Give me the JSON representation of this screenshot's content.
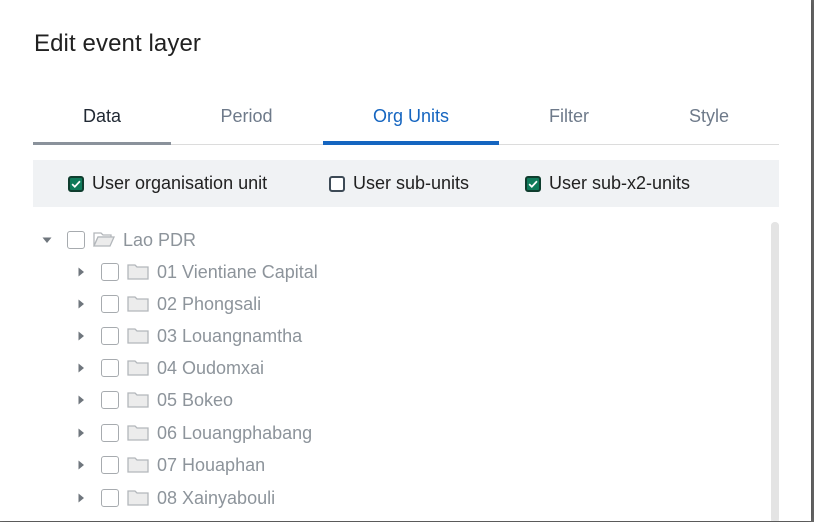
{
  "dialog": {
    "title": "Edit event layer"
  },
  "tabs": [
    {
      "label": "Data",
      "state": "visited"
    },
    {
      "label": "Period",
      "state": "inactive"
    },
    {
      "label": "Org Units",
      "state": "active"
    },
    {
      "label": "Filter",
      "state": "inactive"
    },
    {
      "label": "Style",
      "state": "inactive"
    }
  ],
  "user_levels": [
    {
      "label": "User organisation unit",
      "checked": true
    },
    {
      "label": "User sub-units",
      "checked": false
    },
    {
      "label": "User sub-x2-units",
      "checked": true
    }
  ],
  "tree": {
    "root": {
      "label": "Lao PDR",
      "expanded": true,
      "checked": false,
      "icon": "folder-open-icon"
    },
    "children": [
      {
        "label": "01 Vientiane Capital",
        "checked": false,
        "icon": "folder-icon"
      },
      {
        "label": "02 Phongsali",
        "checked": false,
        "icon": "folder-icon"
      },
      {
        "label": "03 Louangnamtha",
        "checked": false,
        "icon": "folder-icon"
      },
      {
        "label": "04 Oudomxai",
        "checked": false,
        "icon": "folder-icon"
      },
      {
        "label": "05 Bokeo",
        "checked": false,
        "icon": "folder-icon"
      },
      {
        "label": "06 Louangphabang",
        "checked": false,
        "icon": "folder-icon"
      },
      {
        "label": "07 Houaphan",
        "checked": false,
        "icon": "folder-icon"
      },
      {
        "label": "08 Xainyabouli",
        "checked": false,
        "icon": "folder-icon"
      }
    ]
  },
  "colors": {
    "active_tab": "#1565c0",
    "checkbox_checked": "#0f7a5a",
    "tree_text": "#8d949b"
  }
}
